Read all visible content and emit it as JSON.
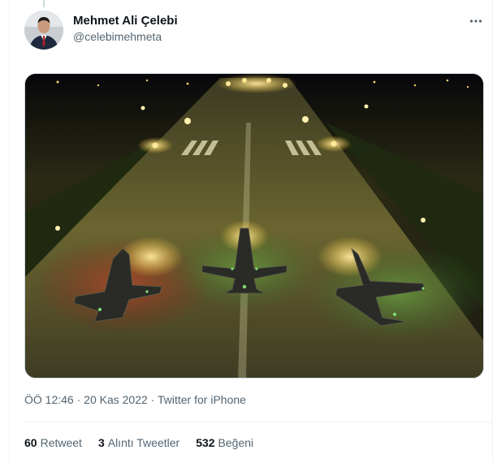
{
  "tweet": {
    "author": {
      "name": "Mehmet Ali Çelebi",
      "handle": "@celebimehmeta"
    },
    "media": {
      "description_icon": "photo-icon"
    },
    "meta": {
      "time": "ÖÖ 12:46",
      "separator1": " · ",
      "date": "20 Kas 2022",
      "separator2": " · ",
      "source": "Twitter for iPhone"
    },
    "stats": [
      {
        "count": "60",
        "label": "Retweet"
      },
      {
        "count": "3",
        "label": "Alıntı Tweetler"
      },
      {
        "count": "532",
        "label": "Beğeni"
      }
    ]
  },
  "icons": {
    "more": "more-horizontal-icon"
  },
  "colors": {
    "secondary_text": "#536471",
    "primary_text": "#0f1419",
    "divider": "#eff3f4"
  }
}
